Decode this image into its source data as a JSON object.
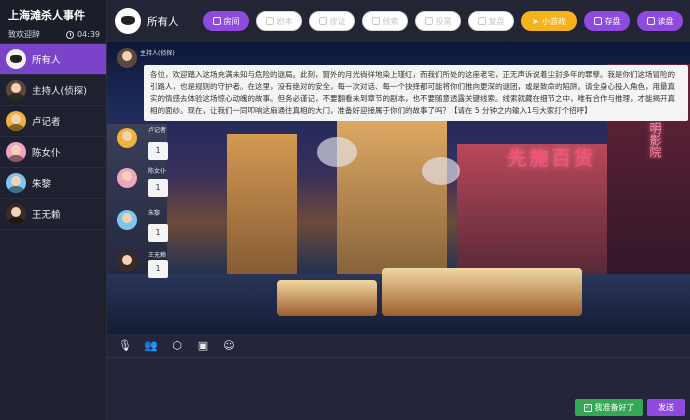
{
  "app": {
    "title": "上海滩杀人事件",
    "welcome": "致欢迎辞",
    "timer": "04:39"
  },
  "sidebar": {
    "items": [
      {
        "label": "所有人",
        "icon": "mask-avatar"
      },
      {
        "label": "主持人(侦探)",
        "icon": "host-avatar"
      },
      {
        "label": "卢记者",
        "icon": "avatar"
      },
      {
        "label": "陈女仆",
        "icon": "avatar"
      },
      {
        "label": "朱黎",
        "icon": "avatar"
      },
      {
        "label": "王无赖",
        "icon": "avatar"
      }
    ]
  },
  "topbar": {
    "title": "所有人",
    "buttons": [
      {
        "label": "房间",
        "icon": "room-icon"
      },
      {
        "label": "剧本",
        "icon": "script-icon"
      },
      {
        "label": "搜证",
        "icon": "search-evidence-icon"
      },
      {
        "label": "线索",
        "icon": "clue-icon"
      },
      {
        "label": "投票",
        "icon": "vote-icon"
      },
      {
        "label": "复盘",
        "icon": "review-icon"
      },
      {
        "label": "小游戏",
        "icon": "game-icon"
      },
      {
        "label": "存盘",
        "icon": "save-icon"
      },
      {
        "label": "读盘",
        "icon": "load-icon"
      }
    ]
  },
  "chat": {
    "host_name": "主持人(侦探)",
    "host_message": "各位，欢迎踏入这场充满未知与危险的谜局。此刻，窗外的月光徜徉地染上瑾红，而我们所处的这座老宅，正无声诉说着尘封多年的罪孽。我是你们这场冒险的引路人，也是规则的守护者。在这里，没有绝对的安全，每一次对话、每一个抉择都可能将你们推向更深的谜团，或是致命的陷阱。请全身心投入角色，用最真实的情感去体验这场惊心动魄的故事。但务必谨记，不要翻看未到章节的剧本，也不要随意透露关键线索。线索就藏在细节之中，唯有合作与推理，才能揭开真相的面纱。现在，让我们一同叩响这扇通往真相的大门，准备好迎接属于你们的故事了吗？【请在 5 分钟之内输入1与大家打个招呼】",
    "replies": [
      {
        "name": "卢记者",
        "text": "1"
      },
      {
        "name": "陈女仆",
        "text": "1"
      },
      {
        "name": "朱黎",
        "text": "1"
      },
      {
        "name": "王无赖",
        "text": "1"
      }
    ]
  },
  "footer": {
    "ready_label": "我准备好了",
    "send_label": "发送"
  }
}
